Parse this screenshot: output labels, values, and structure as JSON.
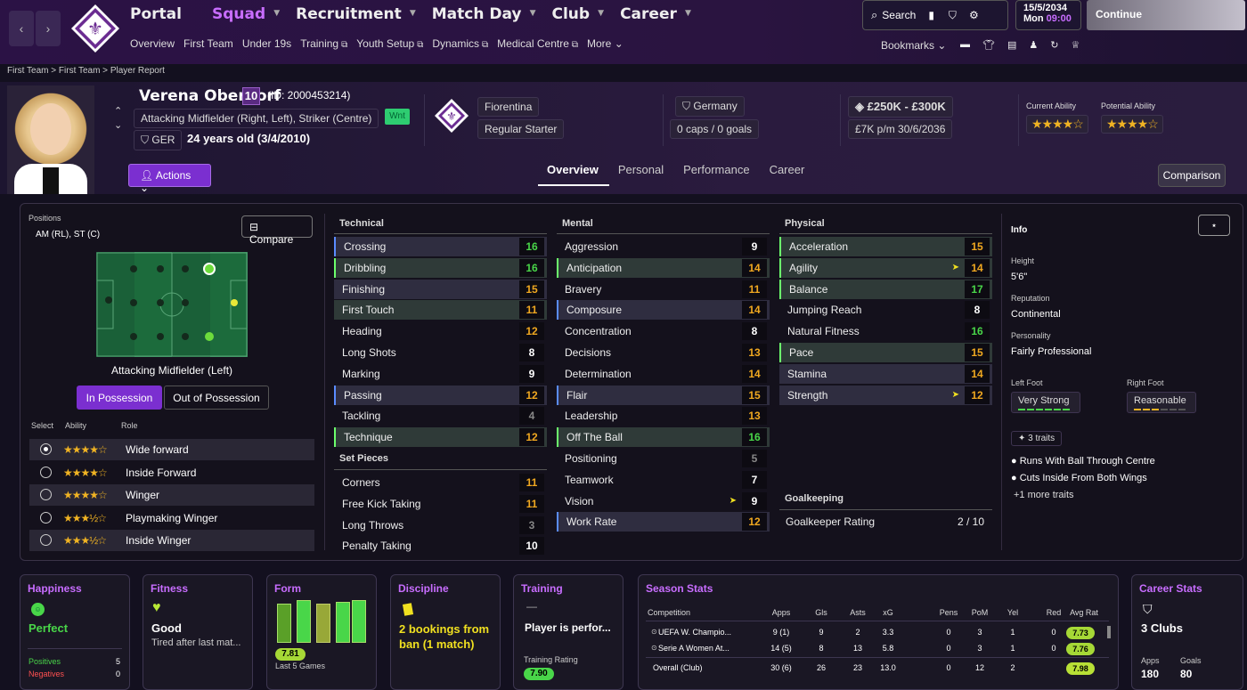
{
  "nav": {
    "main": [
      "Portal",
      "Squad",
      "Recruitment",
      "Match Day",
      "Club",
      "Career"
    ],
    "sub": [
      "Overview",
      "First Team",
      "Under 19s",
      "Training",
      "Youth Setup",
      "Dynamics",
      "Medical Centre",
      "More"
    ],
    "search": "Search",
    "date": "15/5/2034",
    "day": "Mon",
    "time": "09:00",
    "continue": "Continue",
    "bookmarks": "Bookmarks"
  },
  "breadcrumb": [
    "First Team",
    "First Team",
    "Player Report"
  ],
  "player": {
    "name": "Verena Oberdorf",
    "number": "10",
    "id": "(ID: 2000453214)",
    "positions": "Attacking Midfielder (Right, Left), Striker (Centre)",
    "nat_code": "GER",
    "age": "24 years old (3/4/2010)",
    "badge": "Wnt",
    "club": "Fiorentina",
    "status": "Regular Starter",
    "nation": "Germany",
    "caps": "0 caps / 0 goals",
    "value": "£250K - £300K",
    "wage": "£7K p/m 30/6/2036",
    "ca_label": "Current Ability",
    "pa_label": "Potential Ability",
    "ca": "★★★★☆",
    "pa": "★★★★☆"
  },
  "actions": "Actions",
  "tabs": [
    "Overview",
    "Personal",
    "Performance",
    "Career"
  ],
  "comparison": "Comparison",
  "positions": {
    "label": "Positions",
    "value": "AM (RL), ST (C)",
    "compare": "Compare",
    "pitch_label": "Attacking Midfielder (Left)",
    "in_poss": "In Possession",
    "out_poss": "Out of Possession",
    "h_select": "Select",
    "h_ability": "Ability",
    "h_role": "Role",
    "roles": [
      {
        "stars": "★★★★☆",
        "name": "Wide forward"
      },
      {
        "stars": "★★★★☆",
        "name": "Inside Forward"
      },
      {
        "stars": "★★★★☆",
        "name": "Winger"
      },
      {
        "stars": "★★★½☆",
        "name": "Playmaking Winger"
      },
      {
        "stars": "★★★½☆",
        "name": "Inside Winger"
      }
    ]
  },
  "technical": {
    "title": "Technical",
    "rows": [
      [
        "Crossing",
        "16"
      ],
      [
        "Dribbling",
        "16"
      ],
      [
        "Finishing",
        "15"
      ],
      [
        "First Touch",
        "11"
      ],
      [
        "Heading",
        "12"
      ],
      [
        "Long Shots",
        "8"
      ],
      [
        "Marking",
        "9"
      ],
      [
        "Passing",
        "12"
      ],
      [
        "Tackling",
        "4"
      ],
      [
        "Technique",
        "12"
      ]
    ]
  },
  "setpieces": {
    "title": "Set Pieces",
    "rows": [
      [
        "Corners",
        "11"
      ],
      [
        "Free Kick Taking",
        "11"
      ],
      [
        "Long Throws",
        "3"
      ],
      [
        "Penalty Taking",
        "10"
      ]
    ]
  },
  "mental": {
    "title": "Mental",
    "rows": [
      [
        "Aggression",
        "9"
      ],
      [
        "Anticipation",
        "14"
      ],
      [
        "Bravery",
        "11"
      ],
      [
        "Composure",
        "14"
      ],
      [
        "Concentration",
        "8"
      ],
      [
        "Decisions",
        "13"
      ],
      [
        "Determination",
        "14"
      ],
      [
        "Flair",
        "15"
      ],
      [
        "Leadership",
        "13"
      ],
      [
        "Off The Ball",
        "16"
      ],
      [
        "Positioning",
        "5"
      ],
      [
        "Teamwork",
        "7"
      ],
      [
        "Vision",
        "9"
      ],
      [
        "Work Rate",
        "12"
      ]
    ]
  },
  "physical": {
    "title": "Physical",
    "rows": [
      [
        "Acceleration",
        "15"
      ],
      [
        "Agility",
        "14"
      ],
      [
        "Balance",
        "17"
      ],
      [
        "Jumping Reach",
        "8"
      ],
      [
        "Natural Fitness",
        "16"
      ],
      [
        "Pace",
        "15"
      ],
      [
        "Stamina",
        "14"
      ],
      [
        "Strength",
        "12"
      ]
    ]
  },
  "goalkeeping": {
    "title": "Goalkeeping",
    "label": "Goalkeeper Rating",
    "value": "2 / 10"
  },
  "info": {
    "title": "Info",
    "height_l": "Height",
    "height": "5'6\"",
    "rep_l": "Reputation",
    "rep": "Continental",
    "pers_l": "Personality",
    "pers": "Fairly Professional",
    "lf_l": "Left Foot",
    "lf": "Very Strong",
    "rf_l": "Right Foot",
    "rf": "Reasonable",
    "traits_btn": "3 traits",
    "traits": [
      "Runs With Ball Through Centre",
      "Cuts Inside From Both Wings"
    ],
    "more": "+1 more traits"
  },
  "cards": {
    "happiness": {
      "title": "Happiness",
      "value": "Perfect",
      "pos_l": "Positives",
      "pos": "5",
      "neg_l": "Negatives",
      "neg": "0"
    },
    "fitness": {
      "title": "Fitness",
      "value": "Good",
      "sub": "Tired after last mat..."
    },
    "form": {
      "title": "Form",
      "rating": "7.81",
      "sub": "Last 5 Games"
    },
    "discipline": {
      "title": "Discipline",
      "value": "2 bookings from ban (1 match)"
    },
    "training": {
      "title": "Training",
      "dash": "—",
      "value": "Player is perfor...",
      "rating_l": "Training Rating",
      "rating": "7.90"
    },
    "season": {
      "title": "Season Stats",
      "headers": [
        "Competition",
        "Apps",
        "Gls",
        "Asts",
        "xG",
        "Pens",
        "PoM",
        "Yel",
        "Red",
        "Avg Rat"
      ],
      "rows": [
        [
          "UEFA W. Champio...",
          "9 (1)",
          "9",
          "2",
          "3.3",
          "0",
          "3",
          "1",
          "0",
          "7.73"
        ],
        [
          "Serie A Women At...",
          "14 (5)",
          "8",
          "13",
          "5.8",
          "0",
          "3",
          "1",
          "0",
          "7.76"
        ],
        [
          "Overall (Club)",
          "30 (6)",
          "26",
          "23",
          "13.0",
          "0",
          "12",
          "2",
          "",
          "7.98"
        ]
      ]
    },
    "career": {
      "title": "Career Stats",
      "value": "3 Clubs",
      "apps_l": "Apps",
      "apps": "180",
      "goals_l": "Goals",
      "goals": "80"
    }
  }
}
